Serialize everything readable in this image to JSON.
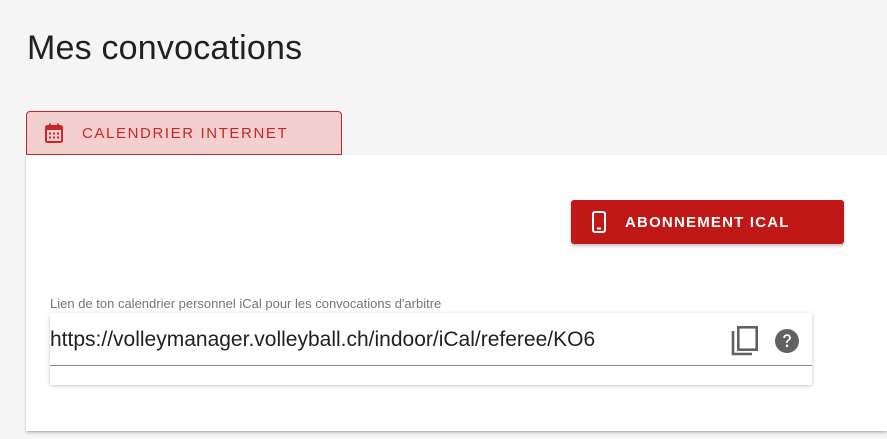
{
  "page": {
    "title": "Mes convocations"
  },
  "tabs": {
    "calendar_label": "CALENDRIER INTERNET",
    "calendar_icon": "calendar-icon"
  },
  "card": {
    "ical_button_label": "ABONNEMENT ICAL",
    "ical_button_icon": "smartphone-icon",
    "field_label": "Lien de ton calendrier personnel iCal pour les convocations d'arbitre",
    "field_value": "https://volleymanager.volleyball.ch/indoor/iCal/referee/KO6",
    "copy_icon": "copy-icon",
    "help_icon": "help-icon"
  },
  "colors": {
    "accent": "#c62828",
    "button_bg": "#c01717",
    "tab_bg": "#f4cfcf",
    "background": "#f5f5f5"
  }
}
